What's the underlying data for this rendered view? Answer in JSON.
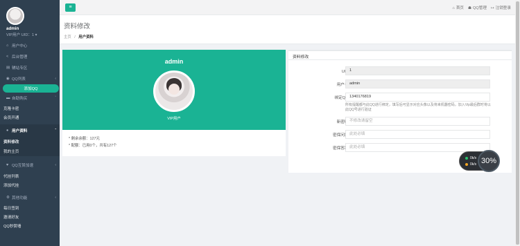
{
  "sidebar": {
    "profile": {
      "name": "admin",
      "vip": "VIP用户 UID：1 ▾"
    },
    "items": [
      {
        "label": "用户中心",
        "icon": "home-icon",
        "glyph": "⌂"
      },
      {
        "label": "后台管理",
        "icon": "share-icon",
        "glyph": "<"
      },
      {
        "label": "辅站专区",
        "icon": "grid-icon",
        "glyph": "▤"
      },
      {
        "label": "QQ列表",
        "icon": "qq-icon",
        "glyph": "◉"
      },
      {
        "label": "添加QQ"
      },
      {
        "label": "自助购买",
        "icon": "cart-icon",
        "glyph": "▬"
      },
      {
        "label": "克隆卡密"
      },
      {
        "label": "会员开通"
      },
      {
        "label": "用户资料",
        "icon": "user-icon",
        "glyph": "●"
      },
      {
        "label": "资料修改"
      },
      {
        "label": "我的主页"
      },
      {
        "label": "QQ互赞加速",
        "icon": "heart-icon",
        "glyph": "♥"
      },
      {
        "label": "代挂列表"
      },
      {
        "label": "添加代挂"
      },
      {
        "label": "其他功能",
        "icon": "cog-icon",
        "glyph": "⚙"
      },
      {
        "label": "每日签到"
      },
      {
        "label": "邀请好友"
      },
      {
        "label": "QQ秒赞墙"
      }
    ]
  },
  "topbar": {
    "menu_glyph": "≡",
    "links": [
      {
        "label": "首页",
        "glyph": "⌂"
      },
      {
        "label": "QQ管理",
        "glyph": "☗"
      },
      {
        "label": "注销登录",
        "glyph": "↦"
      }
    ]
  },
  "heading": {
    "title": "资料修改",
    "crumb_home": "主页",
    "crumb_sep": "/",
    "crumb_current": "用户资料"
  },
  "profile_card": {
    "username": "admin",
    "vip_label": "VIP用户",
    "balance": "* 剩余余额：127元",
    "quota": "* 配额：已用0个，共有127个"
  },
  "form": {
    "title": "资料修改",
    "uid_label": "UID：",
    "uid_value": "1",
    "username_label": "用户名：",
    "username_value": "admin",
    "qq_label": "绑定QQ：",
    "qq_value": "1340176819",
    "qq_help": "所有提醒都与此QQ进行绑定，填写后可显示对应头像以及将来机器密码，加入Vip最后群时将以此QQ号进行验证",
    "password_label": "新密码：",
    "password_placeholder": "不修改请留空",
    "question_label": "密保问题：",
    "question_placeholder": "此处必填",
    "answer_label": "密保答案：",
    "answer_placeholder": "此处必填"
  },
  "speed_widget": {
    "up": "0k/s",
    "down": "0k/s",
    "percent": "30%",
    "up_color": "#29c16c",
    "down_color": "#f5a623"
  }
}
